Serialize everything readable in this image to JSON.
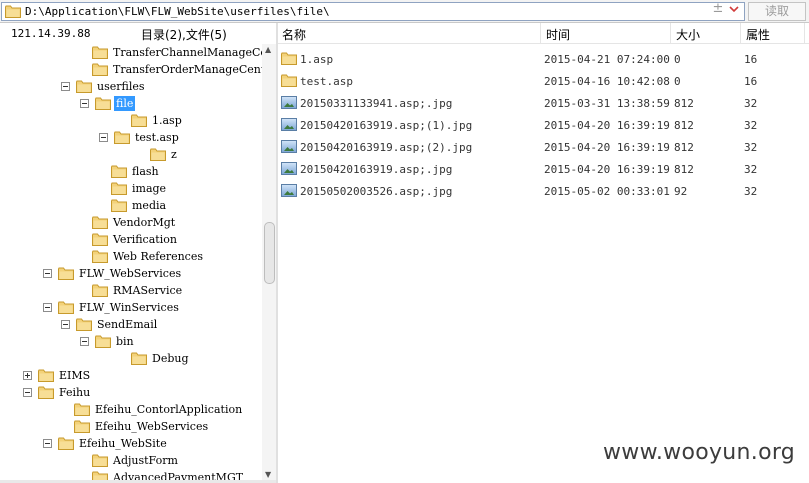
{
  "toolbar": {
    "path": "D:\\Application\\FLW\\FLW_WebSite\\userfiles\\file\\",
    "plus_icon": "plus-sign",
    "read_button": "读取"
  },
  "left_header": {
    "ip": "121.14.39.88",
    "counts": "目录(2),文件(5)"
  },
  "tree": [
    {
      "label": "TransferChannelManageCent",
      "expander": "none"
    },
    {
      "label": "TransferOrderManageCenter",
      "expander": "none"
    },
    {
      "label": "userfiles",
      "expander": "minus"
    },
    {
      "label": "file",
      "expander": "minus",
      "selected": true
    },
    {
      "label": "1.asp",
      "expander": "none"
    },
    {
      "label": "test.asp",
      "expander": "minus"
    },
    {
      "label": "z",
      "expander": "none"
    },
    {
      "label": "flash",
      "expander": "none"
    },
    {
      "label": "image",
      "expander": "none"
    },
    {
      "label": "media",
      "expander": "none"
    },
    {
      "label": "VendorMgt",
      "expander": "none"
    },
    {
      "label": "Verification",
      "expander": "none"
    },
    {
      "label": "Web References",
      "expander": "none"
    },
    {
      "label": "FLW_WebServices",
      "expander": "minus"
    },
    {
      "label": "RMAService",
      "expander": "none"
    },
    {
      "label": "FLW_WinServices",
      "expander": "minus"
    },
    {
      "label": "SendEmail",
      "expander": "minus"
    },
    {
      "label": "bin",
      "expander": "minus"
    },
    {
      "label": "Debug",
      "expander": "none"
    },
    {
      "label": "EIMS",
      "expander": "plus"
    },
    {
      "label": "Feihu",
      "expander": "minus"
    },
    {
      "label": "Efeihu_ContorlApplication",
      "expander": "none"
    },
    {
      "label": "Efeihu_WebServices",
      "expander": "none"
    },
    {
      "label": "Efeihu_WebSite",
      "expander": "minus"
    },
    {
      "label": "AdjustForm",
      "expander": "none"
    },
    {
      "label": "AdvancedPaymentMGT",
      "expander": "none"
    }
  ],
  "list": {
    "headers": {
      "name": "名称",
      "time": "时间",
      "size": "大小",
      "attr": "属性"
    },
    "rows": [
      {
        "icon": "folder",
        "name": "1.asp",
        "time": "2015-04-21 07:24:00",
        "size": "0",
        "attr": "16"
      },
      {
        "icon": "folder",
        "name": "test.asp",
        "time": "2015-04-16 10:42:08",
        "size": "0",
        "attr": "16"
      },
      {
        "icon": "image-file",
        "name": "20150331133941.asp;.jpg",
        "time": "2015-03-31 13:38:59",
        "size": "812",
        "attr": "32"
      },
      {
        "icon": "image-file",
        "name": "20150420163919.asp;(1).jpg",
        "time": "2015-04-20 16:39:19",
        "size": "812",
        "attr": "32"
      },
      {
        "icon": "image-file",
        "name": "20150420163919.asp;(2).jpg",
        "time": "2015-04-20 16:39:19",
        "size": "812",
        "attr": "32"
      },
      {
        "icon": "image-file",
        "name": "20150420163919.asp;.jpg",
        "time": "2015-04-20 16:39:19",
        "size": "812",
        "attr": "32"
      },
      {
        "icon": "image-file",
        "name": "20150502003526.asp;.jpg",
        "time": "2015-05-02 00:33:01",
        "size": "92",
        "attr": "32"
      }
    ]
  },
  "watermark": "www.wooyun.org",
  "colors": {
    "selection": "#3399ff",
    "folder": "#f2c94c"
  }
}
